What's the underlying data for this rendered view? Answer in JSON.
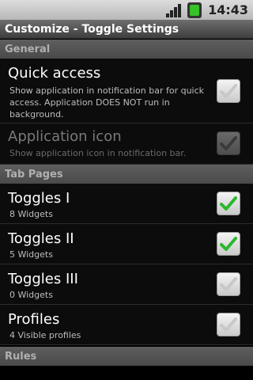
{
  "status_bar": {
    "time": "14:43",
    "icons": [
      "signal-icon",
      "battery-icon"
    ]
  },
  "title_bar": {
    "title": "Customize - Toggle Settings"
  },
  "sections": {
    "general": "General",
    "tab_pages": "Tab Pages",
    "rules": "Rules"
  },
  "settings": {
    "quick_access": {
      "title": "Quick access",
      "summary": "Show application in notification bar for quick access. Application DOES NOT run in background.",
      "checked": false,
      "enabled": true
    },
    "application_icon": {
      "title": "Application icon",
      "summary": "Show application icon in notification bar.",
      "checked": false,
      "enabled": false
    },
    "toggles_1": {
      "title": "Toggles I",
      "summary": "8 Widgets",
      "checked": true,
      "enabled": true
    },
    "toggles_2": {
      "title": "Toggles II",
      "summary": "5 Widgets",
      "checked": true,
      "enabled": true
    },
    "toggles_3": {
      "title": "Toggles III",
      "summary": "0 Widgets",
      "checked": false,
      "enabled": true
    },
    "profiles": {
      "title": "Profiles",
      "summary": "4 Visible profiles",
      "checked": false,
      "enabled": true
    }
  },
  "colors": {
    "check_green": "#2bb72b",
    "check_gray": "#c8c8c8",
    "accent_battery": "#36c229"
  }
}
